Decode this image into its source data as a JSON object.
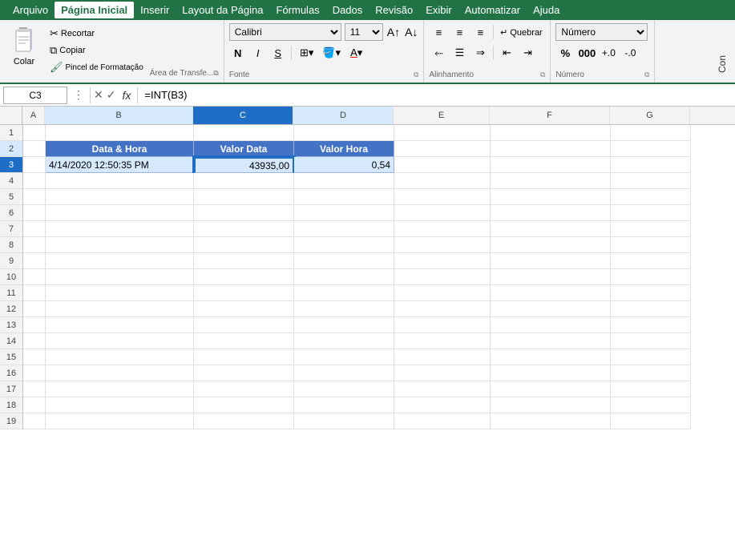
{
  "menuBar": {
    "items": [
      "Arquivo",
      "Página Inicial",
      "Inserir",
      "Layout da Página",
      "Fórmulas",
      "Dados",
      "Revisão",
      "Exibir",
      "Automatizar",
      "Ajuda"
    ],
    "activeItem": "Página Inicial"
  },
  "ribbon": {
    "clipboard": {
      "label": "Área de Transfe...",
      "paste": "Colar",
      "cut": "Recortar",
      "copy": "Copiar",
      "format_painter": "Pincel de Formatação"
    },
    "font": {
      "label": "Fonte",
      "fontName": "Calibri",
      "fontSize": "11",
      "bold": "N",
      "italic": "I",
      "underline": "S",
      "border_btn": "☐",
      "fill_btn": "A",
      "color_btn": "A"
    },
    "alignment": {
      "label": "Alinhamento"
    },
    "number": {
      "label": "Número",
      "format": "Número"
    },
    "partial_right": "Con"
  },
  "formulaBar": {
    "cellRef": "C3",
    "formula": "=INT(B3)",
    "cancelLabel": "✕",
    "confirmLabel": "✓",
    "fxLabel": "fx"
  },
  "columns": {
    "headers": [
      "A",
      "B",
      "C",
      "D",
      "E",
      "F",
      "G"
    ]
  },
  "rows": [
    1,
    2,
    3,
    4,
    5,
    6,
    7,
    8,
    9,
    10,
    11,
    12,
    13,
    14,
    15,
    16,
    17,
    18,
    19
  ],
  "tableHeaders": {
    "B": "Data & Hora",
    "C": "Valor Data",
    "D": "Valor Hora"
  },
  "tableData": {
    "B3": "4/14/2020 12:50:35 PM",
    "C3": "43935,00",
    "D3": "0,54"
  },
  "selectedCell": "C3"
}
